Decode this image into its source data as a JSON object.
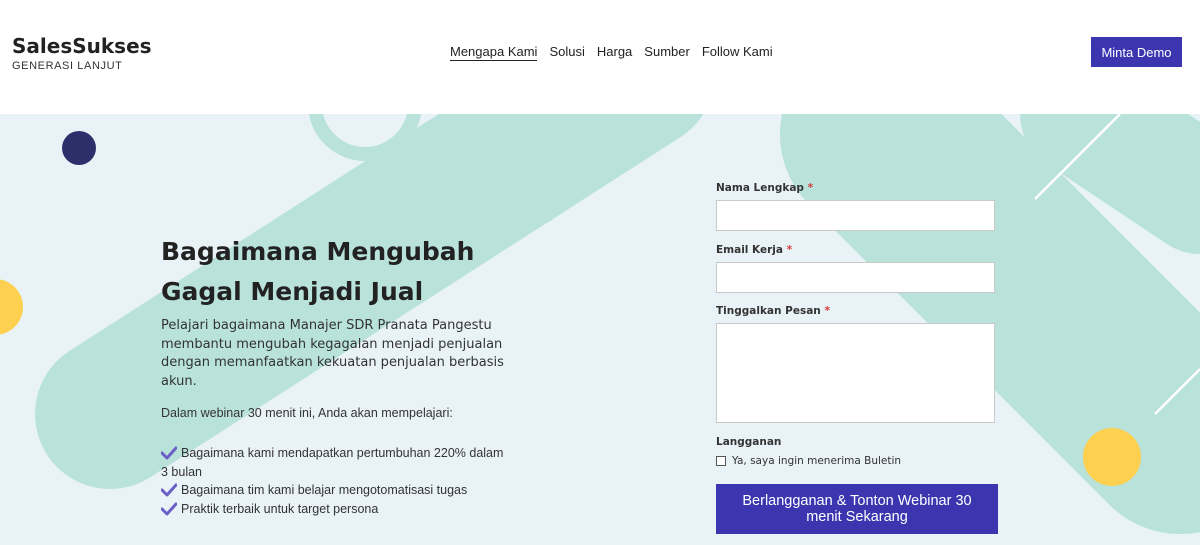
{
  "brand": {
    "name": "SalesSukses",
    "tagline": "GENERASI LANJUT"
  },
  "nav": [
    {
      "label": "Mengapa Kami",
      "active": true
    },
    {
      "label": "Solusi"
    },
    {
      "label": "Harga"
    },
    {
      "label": "Sumber"
    },
    {
      "label": "Follow Kami"
    }
  ],
  "header": {
    "cta_label": "Minta Demo"
  },
  "hero": {
    "headline": "Bagaimana Mengubah Gagal Menjadi Jual",
    "lead": "Pelajari bagaimana Manajer SDR Pranata Pangestu membantu mengubah kegagalan menjadi penjualan dengan memanfaatkan kekuatan penjualan berbasis akun.",
    "intro": "Dalam webinar 30 menit ini, Anda akan mempelajari:",
    "bullets": [
      "Bagaimana kami mendapatkan pertumbuhan 220% dalam 3 bulan",
      "Bagaimana tim kami belajar mengotomatisasi tugas",
      "Praktik terbaik untuk target persona"
    ]
  },
  "form": {
    "name_label": "Nama Lengkap",
    "email_label": "Email Kerja",
    "message_label": "Tinggalkan Pesan",
    "required_mark": "*",
    "subscribe_heading": "Langganan",
    "subscribe_option": "Ya, saya ingin menerima Buletin",
    "submit_label": "Berlangganan & Tonton Webinar 30 menit Sekarang"
  },
  "colors": {
    "accent": "#3b35b0",
    "mint": "#b9e3da",
    "hero_bg": "#e8f2f7",
    "yellow": "#fdd04f",
    "navy": "#2d2f6b",
    "required": "#d23a3a"
  }
}
